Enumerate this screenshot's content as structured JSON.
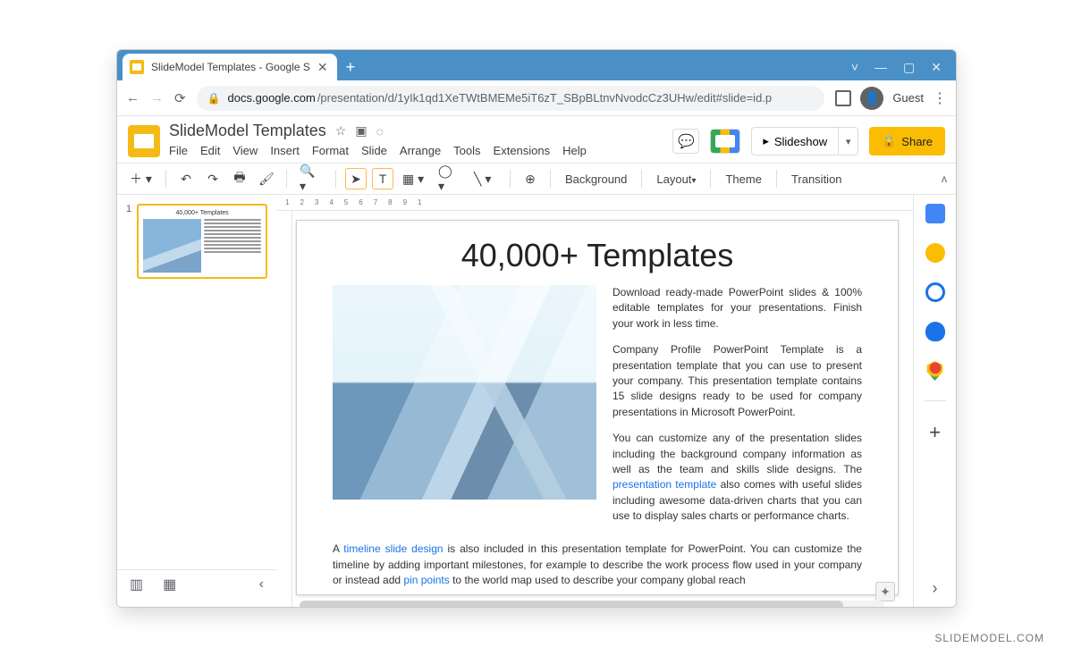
{
  "window": {
    "tab_title": "SlideModel Templates - Google S",
    "controls": {
      "min": "—",
      "max": "▢",
      "close": "✕"
    }
  },
  "browser": {
    "url_domain": "docs.google.com",
    "url_path": "/presentation/d/1yIk1qd1XeTWtBMEMe5iT6zT_SBpBLtnvNvodcCz3UHw/edit#slide=id.p",
    "guest": "Guest"
  },
  "app": {
    "doc_title": "SlideModel Templates",
    "menus": [
      "File",
      "Edit",
      "View",
      "Insert",
      "Format",
      "Slide",
      "Arrange",
      "Tools",
      "Extensions",
      "Help"
    ],
    "slideshow": "Slideshow",
    "share": "Share"
  },
  "toolbar": {
    "background": "Background",
    "layout": "Layout",
    "theme": "Theme",
    "transition": "Transition"
  },
  "filmstrip": {
    "slide_number": "1",
    "thumb_title": "40,000+ Templates"
  },
  "slide": {
    "title": "40,000+ Templates",
    "p1": "Download ready-made PowerPoint slides & 100% editable templates for your presentations. Finish your work in less time.",
    "p2": "Company Profile PowerPoint Template is a presentation template that you can use to present your company. This presentation template contains 15 slide designs ready to be used for company presentations in Microsoft PowerPoint.",
    "p3a": "You can customize any of the presentation slides including the background company information as well as the team and skills slide designs. The ",
    "p3link": "presentation template",
    "p3b": " also comes with useful slides including awesome data-driven charts that you can use to display sales charts or performance charts.",
    "p4a": "A ",
    "p4link1": "timeline slide design",
    "p4b": " is also included in this presentation template for PowerPoint. You can customize the timeline by adding important milestones, for example to describe the work process flow used in your company or instead add  ",
    "p4link2": "pin points",
    "p4c": " to the world map used to describe your company global reach"
  },
  "ruler": "1234567891",
  "watermark": "SLIDEMODEL.COM"
}
